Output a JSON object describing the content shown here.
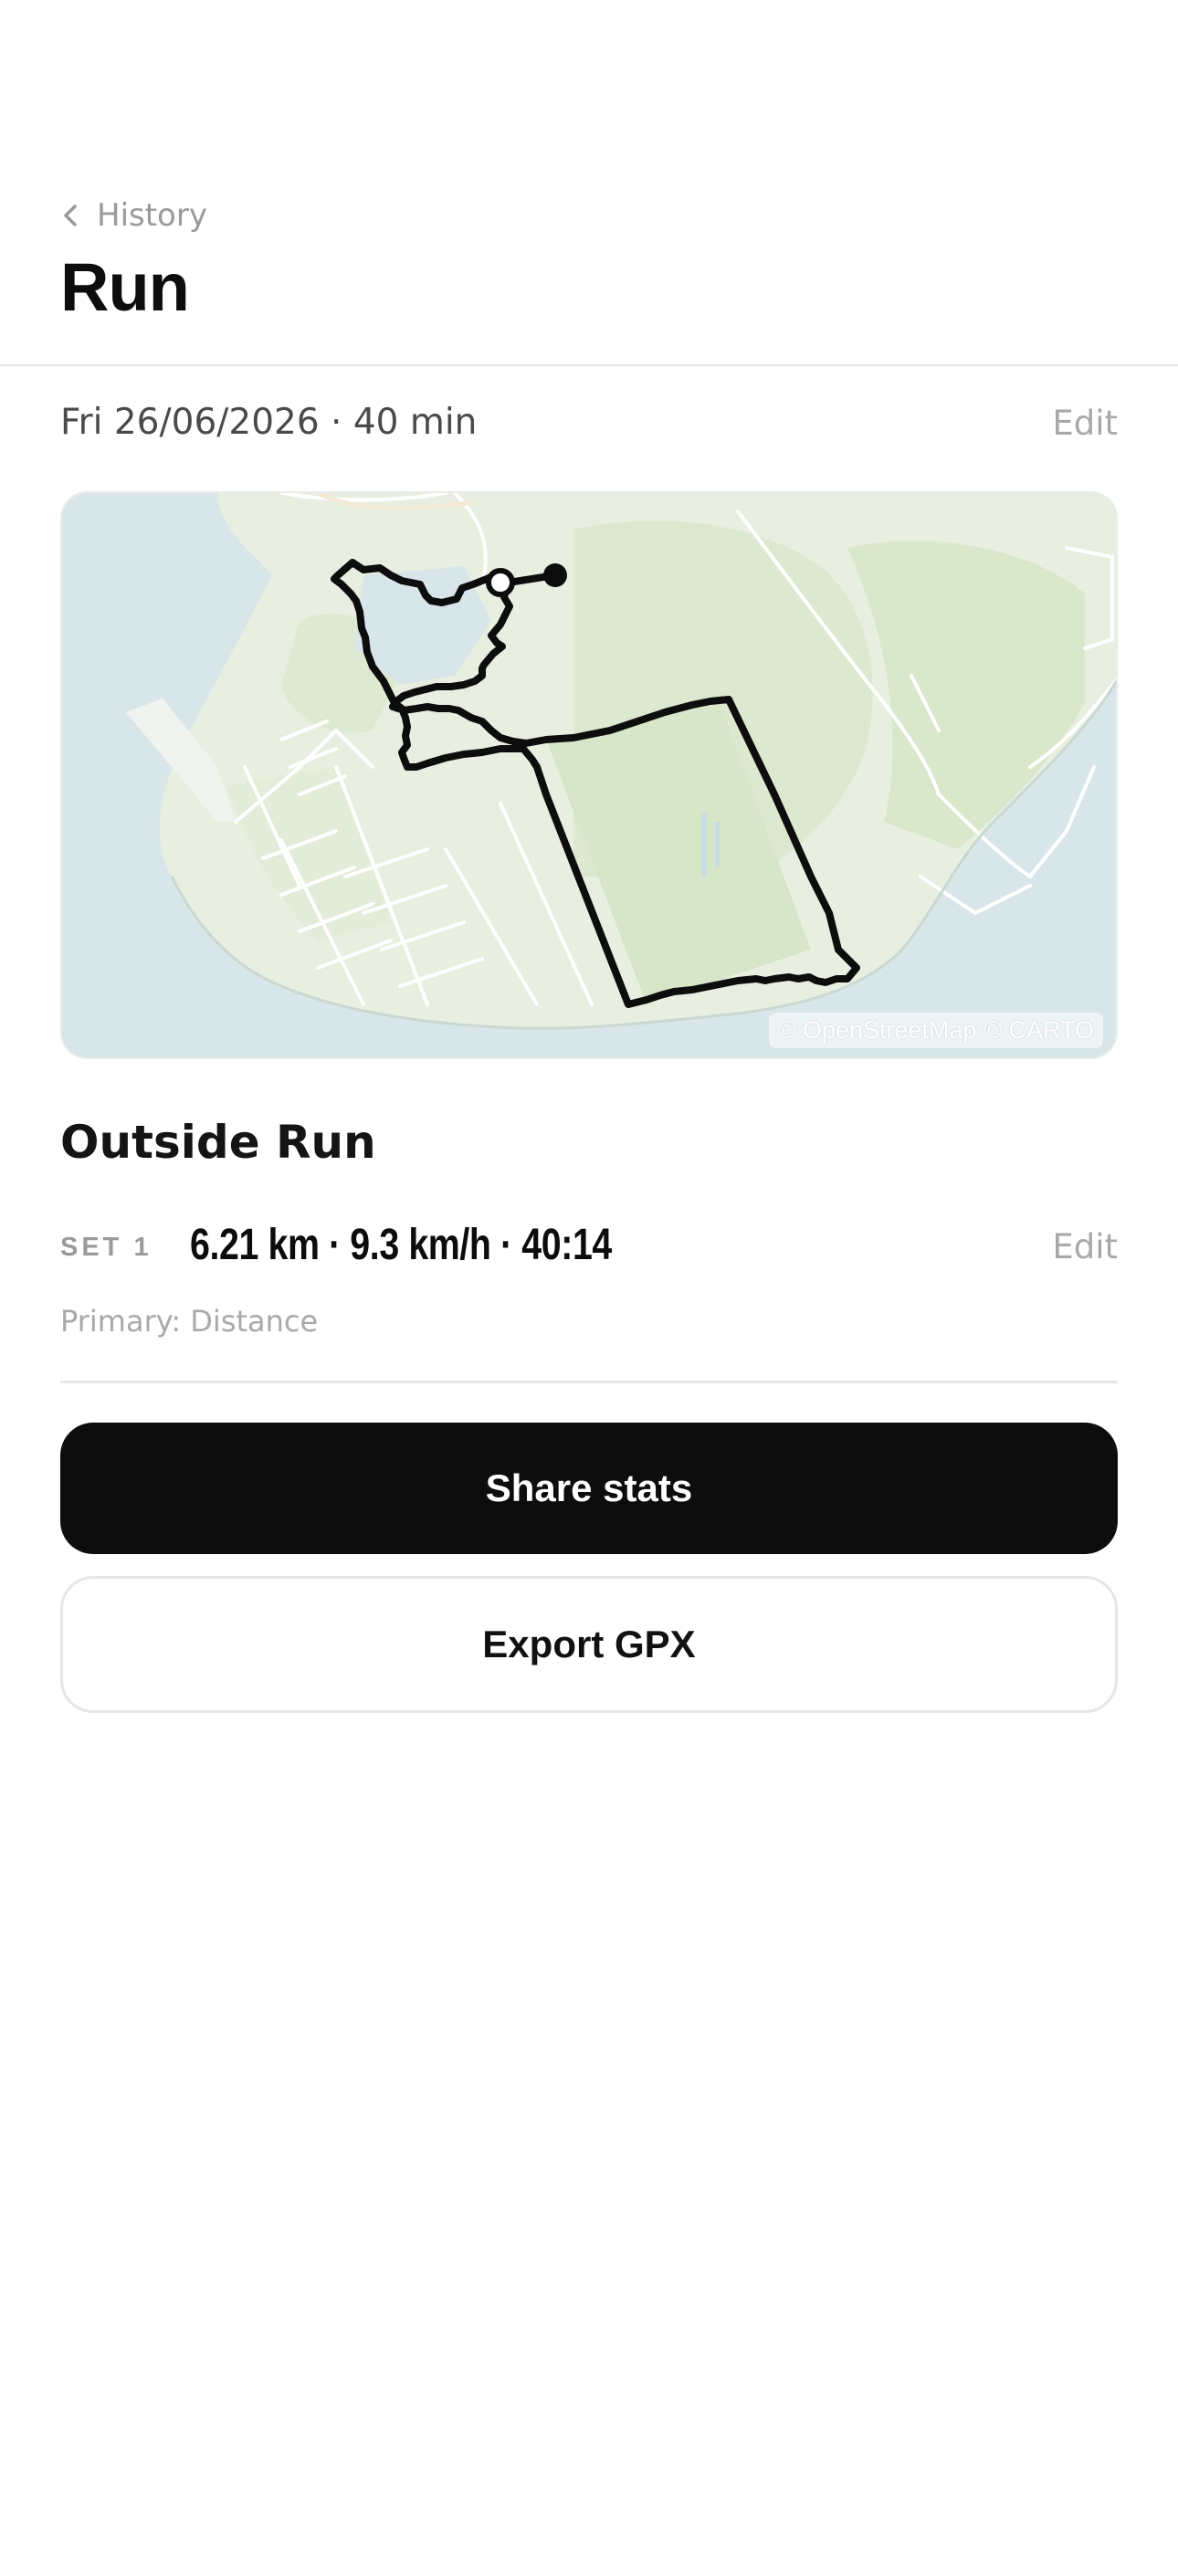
{
  "header": {
    "back_label": "History",
    "title": "Run"
  },
  "session": {
    "meta": "Fri 26/06/2026 · 40 min",
    "edit_label": "Edit"
  },
  "map": {
    "attribution": "© OpenStreetMap © CARTO",
    "colors": {
      "water": "#d8e6ea",
      "land": "#e8efe0",
      "park": "#d9e8cc",
      "road": "#ffffff",
      "route": "#0d0d0d"
    }
  },
  "activity": {
    "name": "Outside Run",
    "set_label": "SET 1",
    "set_value": "6.21 km · 9.3 km/h · 40:14",
    "edit_label": "Edit",
    "primary_metric": "Primary: Distance"
  },
  "actions": {
    "share_label": "Share stats",
    "export_label": "Export GPX"
  }
}
